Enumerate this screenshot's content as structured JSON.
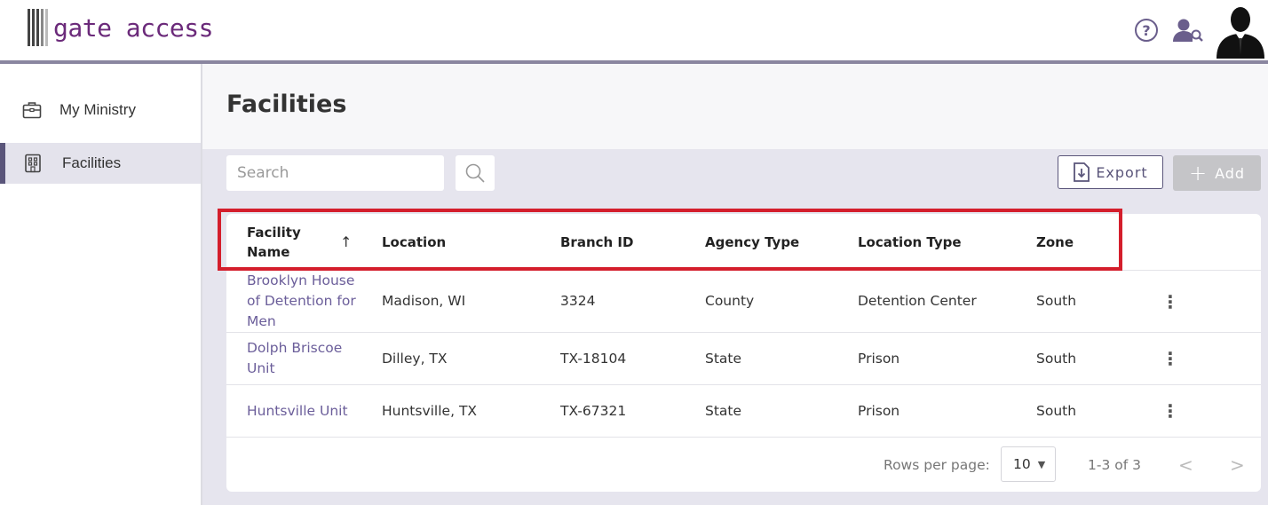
{
  "app": {
    "logo_text": "gate access"
  },
  "header": {
    "help_icon": "question-circle-icon",
    "user_search_icon": "user-search-icon",
    "avatar_icon": "user-avatar"
  },
  "sidebar": {
    "items": [
      {
        "label": "My Ministry",
        "icon": "briefcase-icon",
        "active": false
      },
      {
        "label": "Facilities",
        "icon": "building-icon",
        "active": true
      }
    ]
  },
  "main": {
    "title": "Facilities",
    "search": {
      "placeholder": "Search",
      "value": ""
    },
    "export_label": "Export",
    "add_label": "Add"
  },
  "table": {
    "columns": [
      "Facility Name",
      "Location",
      "Branch ID",
      "Agency Type",
      "Location Type",
      "Zone"
    ],
    "sort_indicator": "↑",
    "rows": [
      [
        "Brooklyn House of Detention for Men",
        "Madison, WI",
        "3324",
        "County",
        "Detention Center",
        "South"
      ],
      [
        "Dolph Briscoe Unit",
        "Dilley, TX",
        "TX-18104",
        "State",
        "Prison",
        "South"
      ],
      [
        "Huntsville Unit",
        "Huntsville, TX",
        "TX-67321",
        "State",
        "Prison",
        "South"
      ]
    ],
    "row_menu": "⋮"
  },
  "pagination": {
    "rows_per_page_label": "Rows per page:",
    "rows_per_page_value": "10",
    "range": "1-3 of 3",
    "prev": "<",
    "next": ">"
  },
  "colors": {
    "accent": "#5a557a",
    "link": "#6b5e9a",
    "highlight": "#d41e2c",
    "logo": "#6b2a7a"
  }
}
